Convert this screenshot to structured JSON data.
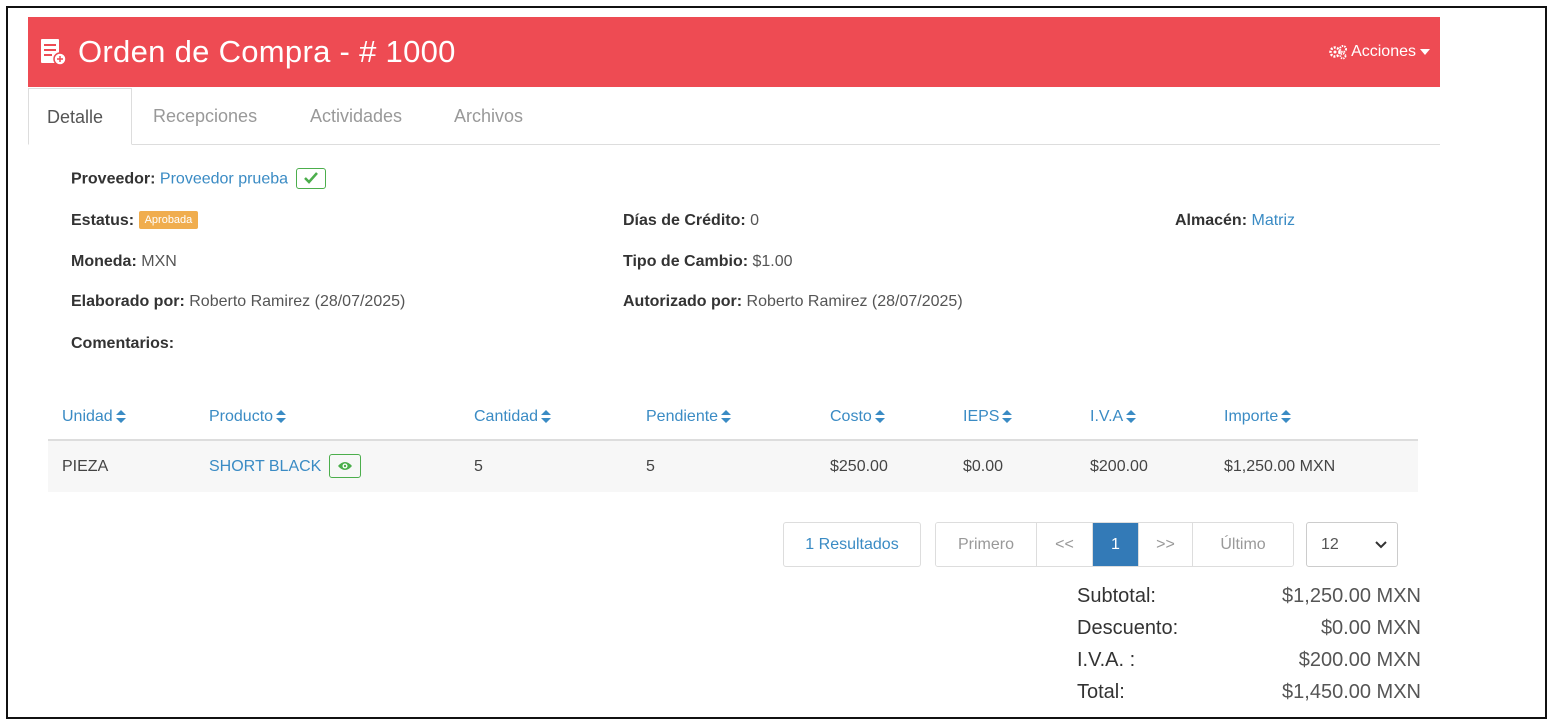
{
  "header": {
    "title": "Orden de Compra - # 1000",
    "actions_label": "Acciones"
  },
  "tabs": [
    {
      "label": "Detalle",
      "active": true
    },
    {
      "label": "Recepciones",
      "active": false
    },
    {
      "label": "Actividades",
      "active": false
    },
    {
      "label": "Archivos",
      "active": false
    }
  ],
  "details": {
    "proveedor_label": "Proveedor:",
    "proveedor_value": "Proveedor prueba",
    "estatus_label": "Estatus:",
    "estatus_value": "Aprobada",
    "dias_credito_label": "Días de Crédito:",
    "dias_credito_value": "0",
    "almacen_label": "Almacén:",
    "almacen_value": "Matriz",
    "moneda_label": "Moneda:",
    "moneda_value": "MXN",
    "tipo_cambio_label": "Tipo de Cambio:",
    "tipo_cambio_value": "$1.00",
    "elaborado_label": "Elaborado por:",
    "elaborado_value": "Roberto Ramirez (28/07/2025)",
    "autorizado_label": "Autorizado por:",
    "autorizado_value": "Roberto Ramirez (28/07/2025)",
    "comentarios_label": "Comentarios:"
  },
  "table": {
    "columns": [
      "Unidad",
      "Producto",
      "Cantidad",
      "Pendiente",
      "Costo",
      "IEPS",
      "I.V.A",
      "Importe"
    ],
    "rows": [
      [
        "PIEZA",
        "SHORT BLACK",
        "5",
        "5",
        "$250.00",
        "$0.00",
        "$200.00",
        "$1,250.00 MXN"
      ]
    ]
  },
  "pagination": {
    "results": "1 Resultados",
    "first": "Primero",
    "prev": "<<",
    "current": "1",
    "next": ">>",
    "last": "Último",
    "page_size": "12"
  },
  "totals": {
    "subtotal_label": "Subtotal:",
    "subtotal_value": "$1,250.00 MXN",
    "descuento_label": "Descuento:",
    "descuento_value": "$0.00 MXN",
    "iva_label": "I.V.A. :",
    "iva_value": "$200.00 MXN",
    "total_label": "Total:",
    "total_value": "$1,450.00 MXN"
  },
  "colors": {
    "header_bg": "#ee4b53",
    "link": "#3a8bc4",
    "badge_warning": "#f0ad4e",
    "success": "#4cae4c",
    "pager_active": "#337ab7"
  }
}
